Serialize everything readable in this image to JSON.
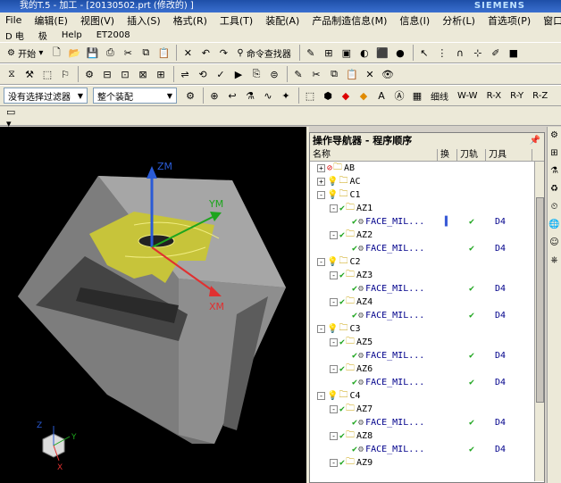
{
  "title": {
    "text": "我的T.5 - 加工 - [20130502.prt (修改的) ]",
    "brand": "SIEMENS"
  },
  "menu": {
    "items": [
      "File",
      "编辑(E)",
      "视图(V)",
      "插入(S)",
      "格式(R)",
      "工具(T)",
      "装配(A)",
      "产品制造信息(M)",
      "信息(I)",
      "分析(L)",
      "首选项(P)",
      "窗口(O)"
    ]
  },
  "menu2": {
    "items": [
      "D 电",
      "极",
      "Help",
      "ET2008"
    ]
  },
  "toolbar1": {
    "start_label": "开始",
    "command_finder_label": "命令查找器"
  },
  "toolbar2": {
    "selection_filter": "没有选择过滤器",
    "assembly_scope": "整个装配",
    "view_buttons": [
      "细线",
      "W-W",
      "R-X",
      "R-Y",
      "R-Z"
    ]
  },
  "viewport": {
    "axes": {
      "z": "ZM",
      "y": "YM",
      "x": "XM"
    },
    "triad": {
      "z": "Z",
      "y": "Y",
      "x": "X"
    },
    "colors": {
      "background": "#000000",
      "part": "#8a8a8a",
      "path": "#c7c43a",
      "z": "#2a5bd6",
      "y": "#1da51d",
      "x": "#e03030"
    }
  },
  "navigator": {
    "title": "操作导航器 - 程序顺序",
    "columns": [
      "名称",
      "换",
      "刀轨",
      "刀具"
    ],
    "rows": [
      {
        "indent": 0,
        "exp": "+",
        "status": "forbid",
        "type": "group",
        "name": "AB"
      },
      {
        "indent": 0,
        "exp": "+",
        "status": "bulb",
        "type": "group",
        "name": "AC"
      },
      {
        "indent": 0,
        "exp": "-",
        "status": "bulb",
        "type": "group",
        "name": "C1"
      },
      {
        "indent": 1,
        "exp": "-",
        "status": "check",
        "type": "group",
        "name": "AZ1"
      },
      {
        "indent": 2,
        "exp": "",
        "status": "check",
        "type": "op",
        "name": "FACE_MIL...",
        "swap": "▌",
        "path": "✔",
        "tool": "D4"
      },
      {
        "indent": 1,
        "exp": "-",
        "status": "check",
        "type": "group",
        "name": "AZ2"
      },
      {
        "indent": 2,
        "exp": "",
        "status": "check",
        "type": "op",
        "name": "FACE_MIL...",
        "path": "✔",
        "tool": "D4"
      },
      {
        "indent": 0,
        "exp": "-",
        "status": "bulb",
        "type": "group",
        "name": "C2"
      },
      {
        "indent": 1,
        "exp": "-",
        "status": "check",
        "type": "group",
        "name": "AZ3"
      },
      {
        "indent": 2,
        "exp": "",
        "status": "check",
        "type": "op",
        "name": "FACE_MIL...",
        "path": "✔",
        "tool": "D4"
      },
      {
        "indent": 1,
        "exp": "-",
        "status": "check",
        "type": "group",
        "name": "AZ4"
      },
      {
        "indent": 2,
        "exp": "",
        "status": "check",
        "type": "op",
        "name": "FACE_MIL...",
        "path": "✔",
        "tool": "D4"
      },
      {
        "indent": 0,
        "exp": "-",
        "status": "bulb",
        "type": "group",
        "name": "C3"
      },
      {
        "indent": 1,
        "exp": "-",
        "status": "check",
        "type": "group",
        "name": "AZ5"
      },
      {
        "indent": 2,
        "exp": "",
        "status": "check",
        "type": "op",
        "name": "FACE_MIL...",
        "path": "✔",
        "tool": "D4"
      },
      {
        "indent": 1,
        "exp": "-",
        "status": "check",
        "type": "group",
        "name": "AZ6"
      },
      {
        "indent": 2,
        "exp": "",
        "status": "check",
        "type": "op",
        "name": "FACE_MIL...",
        "path": "✔",
        "tool": "D4"
      },
      {
        "indent": 0,
        "exp": "-",
        "status": "bulb",
        "type": "group",
        "name": "C4"
      },
      {
        "indent": 1,
        "exp": "-",
        "status": "check",
        "type": "group",
        "name": "AZ7"
      },
      {
        "indent": 2,
        "exp": "",
        "status": "check",
        "type": "op",
        "name": "FACE_MIL...",
        "path": "✔",
        "tool": "D4"
      },
      {
        "indent": 1,
        "exp": "-",
        "status": "check",
        "type": "group",
        "name": "AZ8"
      },
      {
        "indent": 2,
        "exp": "",
        "status": "check",
        "type": "op",
        "name": "FACE_MIL...",
        "path": "✔",
        "tool": "D4"
      },
      {
        "indent": 1,
        "exp": "-",
        "status": "check",
        "type": "group",
        "name": "AZ9"
      }
    ]
  }
}
